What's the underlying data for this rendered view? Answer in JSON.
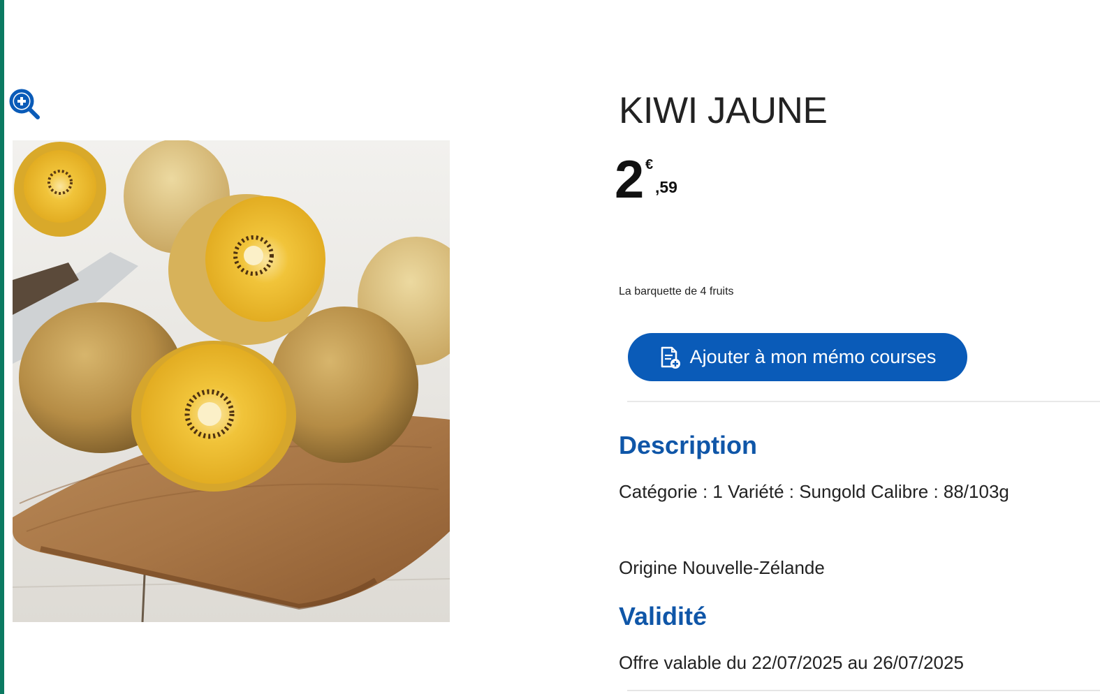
{
  "product": {
    "title": "KIWI JAUNE",
    "price": {
      "integer": "2",
      "currency": "€",
      "decimal": ",59"
    },
    "unit_text": "La barquette de 4 fruits"
  },
  "actions": {
    "memo_label": "Ajouter à mon mémo courses"
  },
  "description": {
    "heading": "Description",
    "line1": "Catégorie : 1 Variété : Sungold Calibre : 88/103g",
    "line2": "Origine Nouvelle-Zélande"
  },
  "validity": {
    "heading": "Validité",
    "text": "Offre valable du 22/07/2025 au 26/07/2025"
  },
  "icons": {
    "zoom": "zoom-in-icon",
    "memo": "memo-list-add-icon"
  },
  "colors": {
    "accent": "#0a5bb8",
    "heading": "#0f56a8",
    "left_stripe": "#0b7a62"
  }
}
